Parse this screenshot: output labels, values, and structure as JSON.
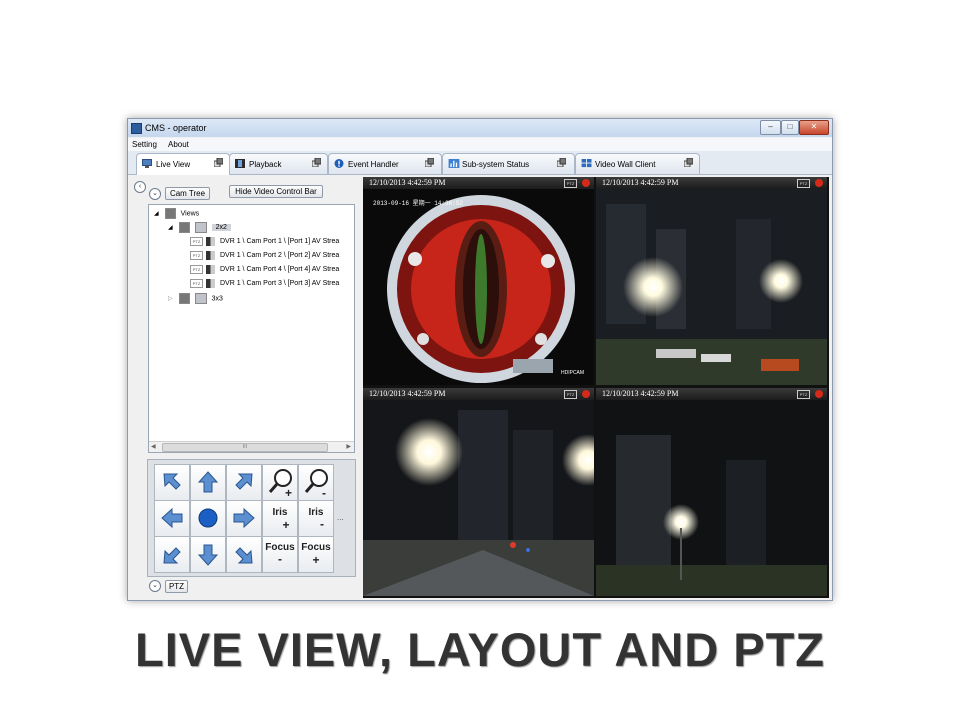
{
  "window": {
    "title": "CMS - operator",
    "menu": [
      "Setting",
      "About"
    ]
  },
  "tabs": [
    {
      "label": "Live View",
      "icon": "monitor-icon"
    },
    {
      "label": "Playback",
      "icon": "film-icon"
    },
    {
      "label": "Event Handler",
      "icon": "info-icon"
    },
    {
      "label": "Sub-system Status",
      "icon": "bar-chart-icon"
    },
    {
      "label": "Video Wall Client",
      "icon": "video-wall-icon"
    }
  ],
  "left_panel": {
    "cam_tree_label": "Cam Tree",
    "hide_button": "Hide Video Control Bar",
    "ptz_label": "PTZ",
    "tree": {
      "root": "Views",
      "view_2x2": "2x2",
      "view_3x3": "3x3",
      "cameras": [
        "DVR 1 \\ Cam Port 1 \\ [Port 1] AV Strea",
        "DVR 1 \\ Cam Port 2 \\ [Port 2] AV Strea",
        "DVR 1 \\ Cam Port 4 \\ [Port 4] AV Strea",
        "DVR 1 \\ Cam Port 3 \\ [Port 3] AV Strea"
      ],
      "cam_badge": "PTZ",
      "scroll_grip": "III"
    }
  },
  "ptz_controls": {
    "iris": "Iris",
    "focus": "Focus",
    "plus": "+",
    "minus": "-",
    "more": "..."
  },
  "video_cells": [
    {
      "timestamp": "12/10/2013 4:42:59 PM",
      "badge": "PTZ",
      "overlay_top": "2013-09-16 星期一 14:36:52",
      "overlay_bottom": "HDIPCAM"
    },
    {
      "timestamp": "12/10/2013 4:42:59 PM",
      "badge": "PTZ"
    },
    {
      "timestamp": "12/10/2013 4:42:59 PM",
      "badge": "PTZ"
    },
    {
      "timestamp": "12/10/2013 4:42:59 PM",
      "badge": "PTZ"
    }
  ],
  "slide_caption": "LIVE VIEW, LAYOUT AND PTZ"
}
